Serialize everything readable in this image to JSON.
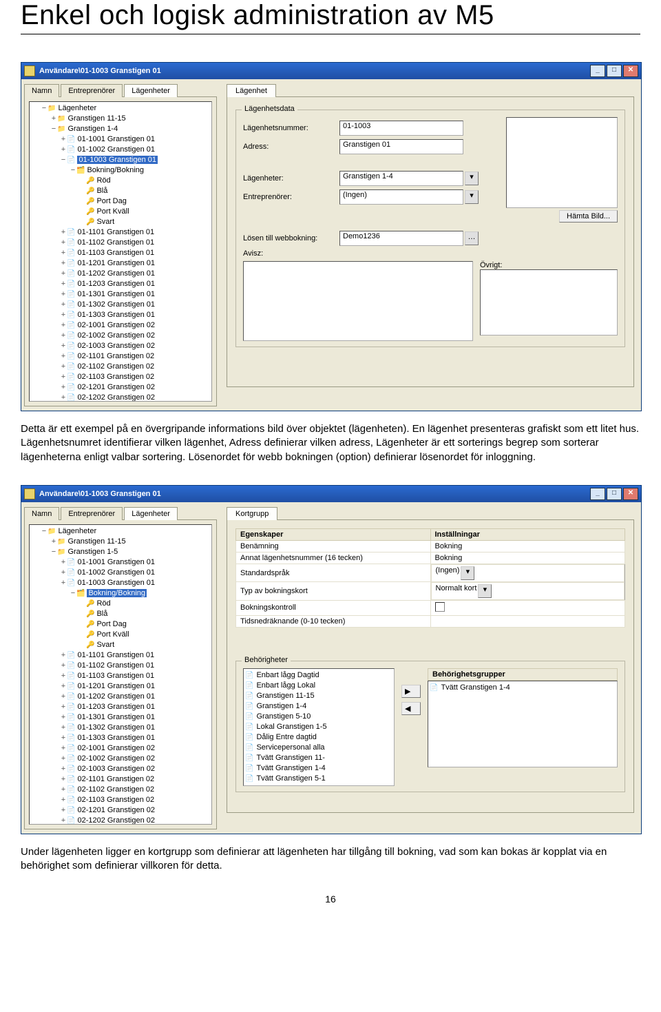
{
  "page": {
    "title": "Enkel och logisk administration av M5",
    "paragraph1": "Detta är ett exempel på en övergripande informations bild över objektet (lägenheten). En lägenhet presenteras grafiskt som ett litet hus. Lägenhetsnumret identifierar vilken lägenhet, Adress definierar vilken adress, Lägenheter är ett sorterings begrep som sorterar lägenheterna enligt valbar sortering. Lösenordet för webb bokningen (option) definierar lösenordet för inloggning.",
    "paragraph2": "Under lägenheten ligger en kortgrupp som definierar att lägenheten har tillgång till bokning, vad som kan bokas är kopplat via en behörighet som definierar villkoren för detta.",
    "page_number": "16"
  },
  "win1": {
    "title": "Användare\\01-1003 Granstigen 01",
    "tabs_left": [
      "Namn",
      "Entreprenörer",
      "Lägenheter"
    ],
    "tab_right": "Lägenhet",
    "tree_root": "Lägenheter",
    "tree_branch1": "Granstigen 11-15",
    "tree_branch2": "Granstigen 1-4",
    "tree_items_top": [
      "01-1001 Granstigen 01",
      "01-1002 Granstigen 01"
    ],
    "tree_selected": "01-1003 Granstigen 01",
    "tree_sel_child": "Bokning/Bokning",
    "tree_sel_grandchildren": [
      "Röd",
      "Blå",
      "Port Dag",
      "Port Kväll",
      "Svart"
    ],
    "tree_items_bot": [
      "01-1101 Granstigen 01",
      "01-1102 Granstigen 01",
      "01-1103 Granstigen 01",
      "01-1201 Granstigen 01",
      "01-1202 Granstigen 01",
      "01-1203 Granstigen 01",
      "01-1301 Granstigen 01",
      "01-1302 Granstigen 01",
      "01-1303 Granstigen 01",
      "02-1001 Granstigen 02",
      "02-1002 Granstigen 02",
      "02-1003 Granstigen 02",
      "02-1101 Granstigen 02",
      "02-1102 Granstigen 02",
      "02-1103 Granstigen 02",
      "02-1201 Granstigen 02",
      "02-1202 Granstigen 02"
    ],
    "group": "Lägenhetsdata",
    "f_lghnr": "Lägenhetsnummer:",
    "v_lghnr": "01-1003",
    "f_adress": "Adress:",
    "v_adress": "Granstigen 01",
    "f_lagenheter": "Lägenheter:",
    "v_lagenheter": "Granstigen 1-4",
    "f_entre": "Entreprenörer:",
    "v_entre": "(Ingen)",
    "btn_img": "Hämta Bild...",
    "f_losen": "Lösen till webbokning:",
    "v_losen": "Demo1236",
    "f_avisz": "Avisz:",
    "f_ovrigt": "Övrigt:"
  },
  "win2": {
    "title": "Användare\\01-1003 Granstigen 01",
    "tabs_left": [
      "Namn",
      "Entreprenörer",
      "Lägenheter"
    ],
    "tab_right": "Kortgrupp",
    "tree_root": "Lägenheter",
    "tree_branch1": "Granstigen 11-15",
    "tree_branch2": "Granstigen 1-5",
    "tree_items_top": [
      "01-1001 Granstigen 01",
      "01-1002 Granstigen 01",
      "01-1003 Granstigen 01"
    ],
    "tree_selected": "Bokning/Bokning",
    "tree_sel_grandchildren": [
      "Röd",
      "Blå",
      "Port Dag",
      "Port Kväll",
      "Svart"
    ],
    "tree_items_bot": [
      "01-1101 Granstigen 01",
      "01-1102 Granstigen 01",
      "01-1103 Granstigen 01",
      "01-1201 Granstigen 01",
      "01-1202 Granstigen 01",
      "01-1203 Granstigen 01",
      "01-1301 Granstigen 01",
      "01-1302 Granstigen 01",
      "01-1303 Granstigen 01",
      "02-1001 Granstigen 02",
      "02-1002 Granstigen 02",
      "02-1003 Granstigen 02",
      "02-1101 Granstigen 02",
      "02-1102 Granstigen 02",
      "02-1103 Granstigen 02",
      "02-1201 Granstigen 02",
      "02-1202 Granstigen 02"
    ],
    "col_prop": "Egenskaper",
    "col_set": "Inställningar",
    "rows": [
      {
        "k": "Benämning",
        "v": "Bokning"
      },
      {
        "k": "Annat lägenhetsnummer (16 tecken)",
        "v": "Bokning"
      },
      {
        "k": "Standardspråk",
        "v": "(Ingen)"
      },
      {
        "k": "Typ av bokningskort",
        "v": "Normalt kort"
      },
      {
        "k": "Bokningskontroll",
        "v": ""
      },
      {
        "k": "Tidsnedräknande (0-10 tecken)",
        "v": ""
      }
    ],
    "section_beh": "Behörigheter",
    "list_left": [
      "Enbart lågg Dagtid",
      "Enbart lågg Lokal",
      "Granstigen 11-15",
      "Granstigen 1-4",
      "Granstigen 5-10",
      "Lokal Granstigen 1-5",
      "Dålig Entre dagtid",
      "Servicepersonal alla",
      "Tvätt Granstigen 11-",
      "Tvätt Granstigen 1-4",
      "Tvätt Granstigen 5-1"
    ],
    "hdr_right": "Behörighetsgrupper",
    "list_right": [
      "Tvätt Granstigen 1-4"
    ]
  },
  "winbtns": {
    "min": "_",
    "max": "□",
    "close": "✕"
  }
}
